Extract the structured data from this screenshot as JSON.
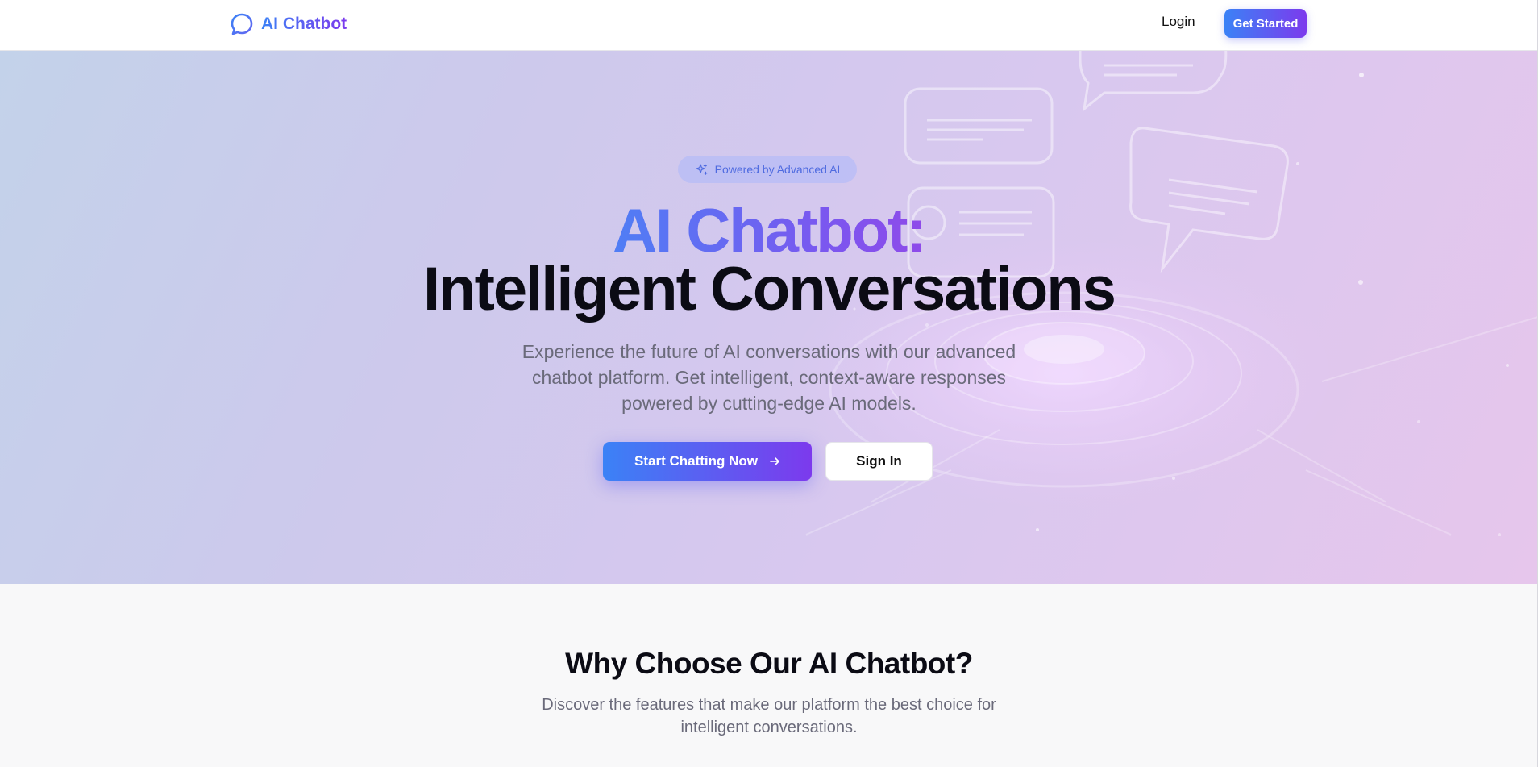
{
  "nav": {
    "brand": "AI Chatbot",
    "login_label": "Login",
    "get_started_label": "Get Started"
  },
  "hero": {
    "badge": "Powered by Advanced AI",
    "title_line1": "AI Chatbot:",
    "title_line2": "Intelligent Conversations",
    "description": "Experience the future of AI conversations with our advanced chatbot platform. Get intelligent, context-aware responses powered by cutting-edge AI models.",
    "primary_cta": "Start Chatting Now",
    "secondary_cta": "Sign In"
  },
  "features": {
    "title": "Why Choose Our AI Chatbot?",
    "description": "Discover the features that make our platform the best choice for intelligent conversations."
  },
  "colors": {
    "brand_start": "#3b82f6",
    "brand_end": "#7c3aed",
    "heading": "#0b0b14",
    "muted_text": "#6a6a7a"
  },
  "icons": {
    "brand": "message-circle-icon",
    "badge": "sparkles-icon",
    "primary_cta": "arrow-right-icon"
  }
}
